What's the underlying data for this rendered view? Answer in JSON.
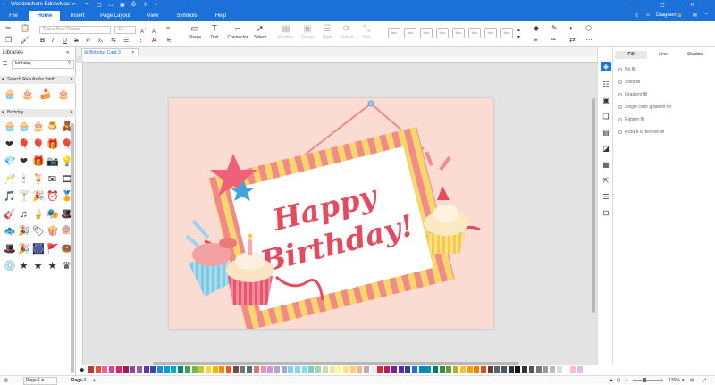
{
  "app": {
    "title": "Wondershare EdrawMax",
    "user": "Diagram"
  },
  "tabs": [
    "File",
    "Home",
    "Insert",
    "Page Layout",
    "View",
    "Symbols",
    "Help"
  ],
  "active_tab": "Home",
  "ribbon": {
    "font_name": "Times New Roman",
    "font_size": "12",
    "tools": [
      "Shape",
      "Text",
      "Connector",
      "Select"
    ],
    "disabled_tools": [
      "Position",
      "Group",
      "Align",
      "Rotate",
      "Size"
    ],
    "style_swatch": "Abc"
  },
  "libraries": {
    "title": "Libraries",
    "search_value": "birthday",
    "search_results": "Search Results for \"birth...",
    "section": "Birthday"
  },
  "document": {
    "tab": "Birthday Card 3",
    "greeting_line1": "Happy",
    "greeting_line2": "Birthday!"
  },
  "fill_panel": {
    "tabs": [
      "Fill",
      "Line",
      "Shadow"
    ],
    "options": [
      "No fill",
      "Solid fill",
      "Gradient fill",
      "Single color gradient fill",
      "Pattern fill",
      "Picture or texture fill"
    ]
  },
  "status": {
    "page_select": "Page-1",
    "page_tab": "Page-1",
    "zoom": "130%"
  },
  "colors": {
    "accent": "#1b71d7",
    "card_bg": "#fbdcd3",
    "frame_pink": "#f28a8a",
    "frame_yellow": "#f7d66c",
    "title_red": "#e34b5f"
  },
  "icons": {
    "birthday": [
      "cupcake-icon",
      "cupcake-icon",
      "cake-icon",
      "dessert-icon",
      "teddy-bear-icon",
      "heart-icon",
      "balloons-icon",
      "balloon-icon",
      "gift-icon",
      "balloon-icon",
      "diamond-icon",
      "heart-icon",
      "gift-icon",
      "camera-icon",
      "bulb-icon",
      "cheers-icon",
      "candles-icon",
      "drink-icon",
      "envelope-icon",
      "film-icon",
      "music-icon",
      "cocktail-icon",
      "party-hat-icon",
      "clock-icon",
      "medal-icon",
      "guitar-icon",
      "note-icon",
      "ice-cream-icon",
      "mask-icon",
      "hat-icon",
      "fish-icon",
      "party-hat-icon",
      "tag-icon",
      "popcorn-icon",
      "lollipop-icon",
      "hat-icon",
      "party-hat-icon",
      "firework-icon",
      "flag-icon",
      "donut-icon",
      "cd-icon",
      "star-icon",
      "star-icon",
      "star-icon",
      "crown-icon"
    ]
  }
}
